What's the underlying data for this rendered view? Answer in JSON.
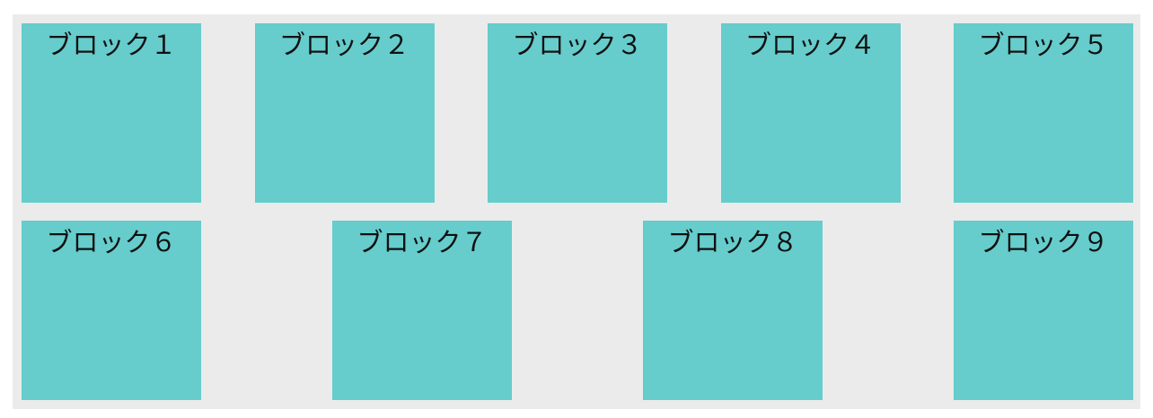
{
  "colors": {
    "container_background": "#ebebeb",
    "block_background": "#66cccc",
    "text": "#111111"
  },
  "rows": [
    {
      "blocks": [
        {
          "label": "ブロック１"
        },
        {
          "label": "ブロック２"
        },
        {
          "label": "ブロック３"
        },
        {
          "label": "ブロック４"
        },
        {
          "label": "ブロック５"
        }
      ]
    },
    {
      "blocks": [
        {
          "label": "ブロック６"
        },
        {
          "label": "ブロック７"
        },
        {
          "label": "ブロック８"
        },
        {
          "label": "ブロック９"
        }
      ]
    }
  ]
}
